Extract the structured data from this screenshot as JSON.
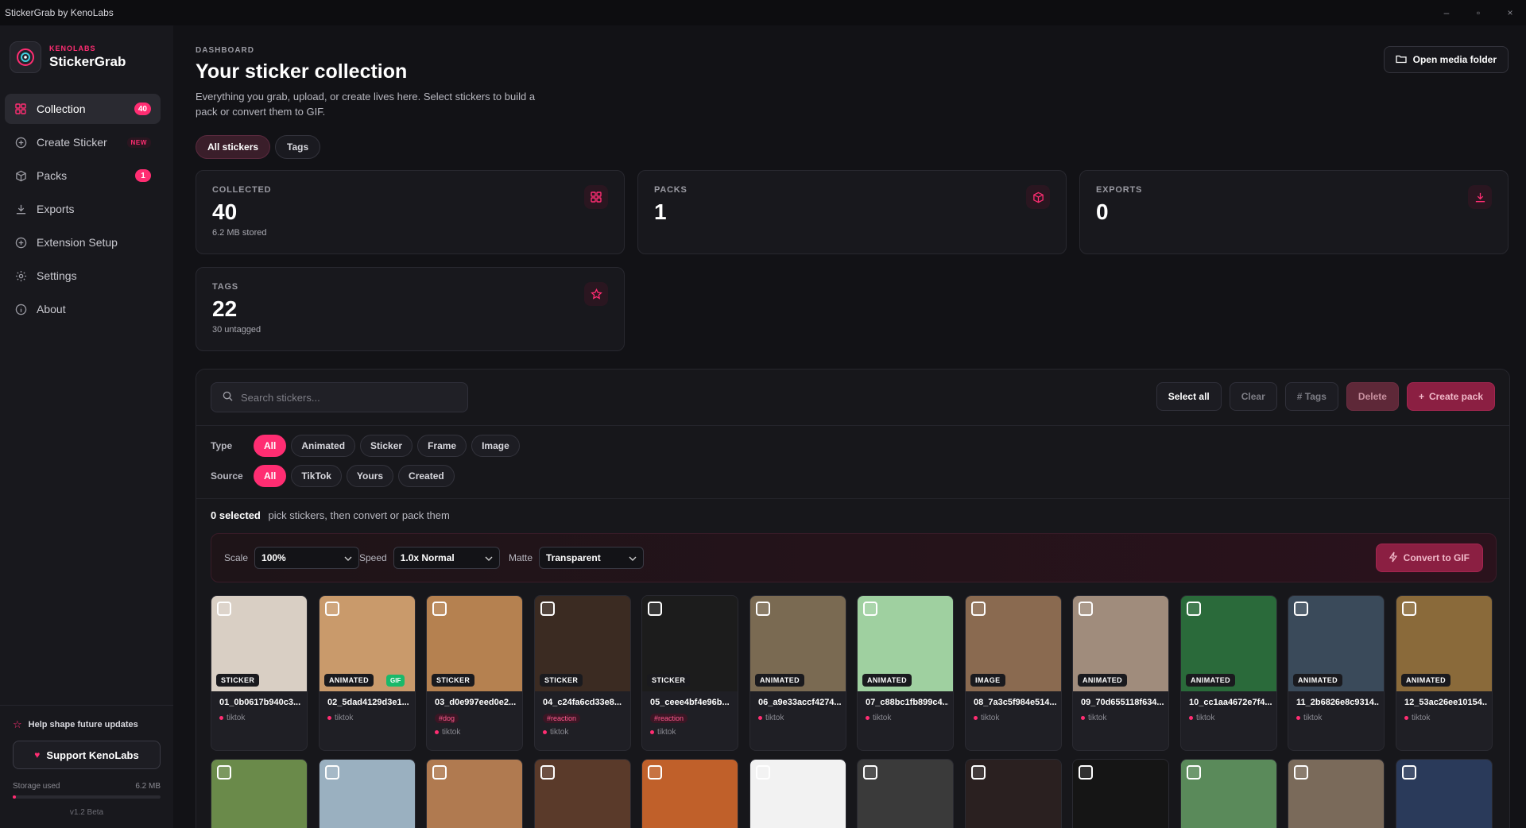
{
  "window": {
    "title": "StickerGrab by KenoLabs",
    "minimize": "–",
    "maximize": "▫",
    "close": "×"
  },
  "brand": {
    "sub": "KENOLABS",
    "name": "StickerGrab"
  },
  "nav": [
    {
      "label": "Collection",
      "icon": "grid-icon",
      "badge": "40",
      "active": true
    },
    {
      "label": "Create Sticker",
      "icon": "plus-circle-icon",
      "tag": "NEW"
    },
    {
      "label": "Packs",
      "icon": "box-icon",
      "badge": "1"
    },
    {
      "label": "Exports",
      "icon": "download-icon"
    },
    {
      "label": "Extension Setup",
      "icon": "plus-circle-icon"
    },
    {
      "label": "Settings",
      "icon": "gear-icon"
    },
    {
      "label": "About",
      "icon": "info-icon"
    }
  ],
  "sidebar_footer": {
    "help": "Help shape future updates",
    "support": "Support KenoLabs",
    "storage_label": "Storage used",
    "storage_value": "6.2 MB",
    "storage_fraction": 0.02,
    "version": "v1.2 Beta"
  },
  "header": {
    "eyebrow": "DASHBOARD",
    "title": "Your sticker collection",
    "description": "Everything you grab, upload, or create lives here. Select stickers to build a pack or convert them to GIF.",
    "open_folder": "Open media folder"
  },
  "tabs": [
    {
      "label": "All stickers",
      "active": true
    },
    {
      "label": "Tags"
    }
  ],
  "stats": [
    {
      "label": "COLLECTED",
      "value": "40",
      "sub": "6.2 MB stored",
      "icon": "grid-icon"
    },
    {
      "label": "PACKS",
      "value": "1",
      "sub": "",
      "icon": "box-icon"
    },
    {
      "label": "EXPORTS",
      "value": "0",
      "sub": "",
      "icon": "download-icon"
    },
    {
      "label": "TAGS",
      "value": "22",
      "sub": "30 untagged",
      "icon": "star-icon"
    }
  ],
  "toolbar": {
    "search_placeholder": "Search stickers...",
    "select_all": "Select all",
    "clear": "Clear",
    "tags": "# Tags",
    "delete": "Delete",
    "create_pack": "Create pack"
  },
  "filters": {
    "type_label": "Type",
    "type_options": [
      "All",
      "Animated",
      "Sticker",
      "Frame",
      "Image"
    ],
    "source_label": "Source",
    "source_options": [
      "All",
      "TikTok",
      "Yours",
      "Created"
    ]
  },
  "selection": {
    "count": "0 selected",
    "hint": "pick stickers, then convert or pack them"
  },
  "convert": {
    "scale_label": "Scale",
    "scale_value": "100%",
    "speed_label": "Speed",
    "speed_value": "1.0x Normal",
    "matte_label": "Matte",
    "matte_value": "Transparent",
    "button": "Convert to GIF"
  },
  "stickers": [
    {
      "name": "01_0b0617b940c3...",
      "badge": "STICKER",
      "source": "tiktok",
      "tag": "",
      "color": "#d9cfc4"
    },
    {
      "name": "02_5dad4129d3e1...",
      "badge": "ANIMATED",
      "gif": "GIF",
      "source": "tiktok",
      "tag": "",
      "color": "#c99a6b"
    },
    {
      "name": "03_d0e997eed0e2...",
      "badge": "STICKER",
      "source": "tiktok",
      "tag": "#dog",
      "color": "#b58150"
    },
    {
      "name": "04_c24fa6cd33e8...",
      "badge": "STICKER",
      "source": "tiktok",
      "tag": "#reaction",
      "color": "#3b2b22"
    },
    {
      "name": "05_ceee4bf4e96b...",
      "badge": "STICKER",
      "source": "tiktok",
      "tag": "#reaction",
      "color": "#1c1c1c"
    },
    {
      "name": "06_a9e33accf4274...",
      "badge": "ANIMATED",
      "source": "tiktok",
      "tag": "",
      "color": "#7a6a52"
    },
    {
      "name": "07_c88bc1fb899c4...",
      "badge": "ANIMATED",
      "source": "tiktok",
      "tag": "",
      "color": "#9fd0a0"
    },
    {
      "name": "08_7a3c5f984e514...",
      "badge": "IMAGE",
      "source": "tiktok",
      "tag": "",
      "color": "#8a6a50"
    },
    {
      "name": "09_70d655118f634...",
      "badge": "ANIMATED",
      "source": "tiktok",
      "tag": "",
      "color": "#a08c7c"
    },
    {
      "name": "10_cc1aa4672e7f4...",
      "badge": "ANIMATED",
      "source": "tiktok",
      "tag": "",
      "color": "#2a6a3a"
    },
    {
      "name": "11_2b6826e8c9314...",
      "badge": "ANIMATED",
      "source": "tiktok",
      "tag": "",
      "color": "#3a4a5a"
    },
    {
      "name": "12_53ac26ee10154...",
      "badge": "ANIMATED",
      "source": "tiktok",
      "tag": "",
      "color": "#8a6a3a"
    }
  ],
  "stickers_row2": [
    {
      "color": "#6a8a4a"
    },
    {
      "color": "#9ab0c0"
    },
    {
      "color": "#b07a50"
    },
    {
      "color": "#5a3a2a"
    },
    {
      "color": "#c0602a"
    },
    {
      "color": "#f2f2f2"
    },
    {
      "color": "#3a3a3a"
    },
    {
      "color": "#2a2020"
    },
    {
      "color": "#151515"
    },
    {
      "color": "#5a8a5a"
    },
    {
      "color": "#7a6a5a"
    },
    {
      "color": "#2a3a5a"
    }
  ]
}
